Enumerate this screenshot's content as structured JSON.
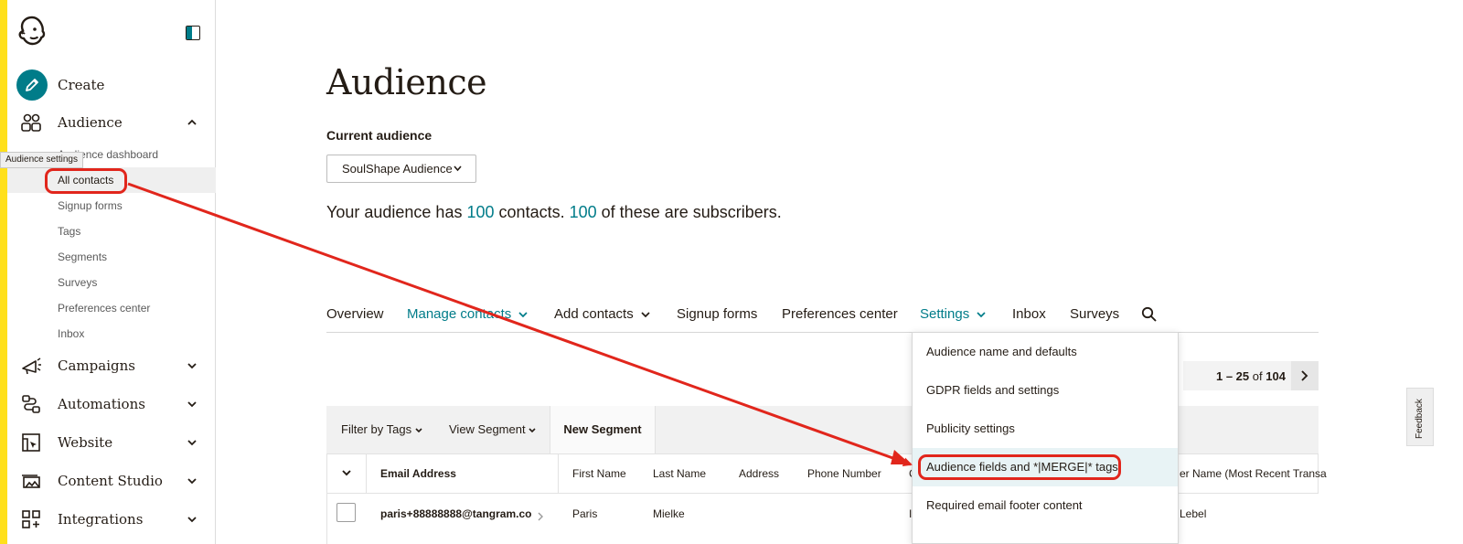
{
  "sidebar": {
    "create_label": "Create",
    "audience_label": "Audience",
    "tooltip": "Audience settings",
    "sub_items": [
      {
        "label": "Audience dashboard"
      },
      {
        "label": "All contacts"
      },
      {
        "label": "Signup forms"
      },
      {
        "label": "Tags"
      },
      {
        "label": "Segments"
      },
      {
        "label": "Surveys"
      },
      {
        "label": "Preferences center"
      },
      {
        "label": "Inbox"
      }
    ],
    "items": [
      {
        "label": "Campaigns",
        "icon": "megaphone-icon"
      },
      {
        "label": "Automations",
        "icon": "workflow-icon"
      },
      {
        "label": "Website",
        "icon": "cursor-window-icon"
      },
      {
        "label": "Content Studio",
        "icon": "image-stack-icon"
      },
      {
        "label": "Integrations",
        "icon": "grid-plus-icon"
      }
    ]
  },
  "main": {
    "title": "Audience",
    "current_audience_label": "Current audience",
    "selected_audience": "SoulShape Audience",
    "summary": {
      "prefix": "Your audience has",
      "contacts": "100",
      "middle": "contacts.",
      "subscribers": "100",
      "suffix": "of these are subscribers."
    },
    "tabs": [
      {
        "label": "Overview"
      },
      {
        "label": "Manage contacts"
      },
      {
        "label": "Add contacts"
      },
      {
        "label": "Signup forms"
      },
      {
        "label": "Preferences center"
      },
      {
        "label": "Settings"
      },
      {
        "label": "Inbox"
      },
      {
        "label": "Surveys"
      }
    ],
    "pagination": {
      "range": "1 – 25",
      "of_label": "of",
      "total": "104"
    },
    "filters": {
      "tags": "Filter by Tags",
      "segment": "View Segment",
      "new_segment": "New Segment"
    },
    "columns": [
      "Email Address",
      "First Name",
      "Last Name",
      "Address",
      "Phone Number",
      "C",
      "er Name (Most Recent Transa"
    ],
    "row": {
      "email": "paris+88888888@tangram.co",
      "first": "Paris",
      "last": "Mielke",
      "partial": "I",
      "last_col": "Lebel"
    }
  },
  "settings_menu": [
    {
      "label": "Audience name and defaults"
    },
    {
      "label": "GDPR fields and settings"
    },
    {
      "label": "Publicity settings"
    },
    {
      "label": "Audience fields and *|MERGE|* tags"
    },
    {
      "label": "Required email footer content"
    }
  ],
  "feedback_label": "Feedback",
  "colors": {
    "accent": "#007c89",
    "brand_yellow": "#ffe01b",
    "annotation": "#e1261c"
  }
}
